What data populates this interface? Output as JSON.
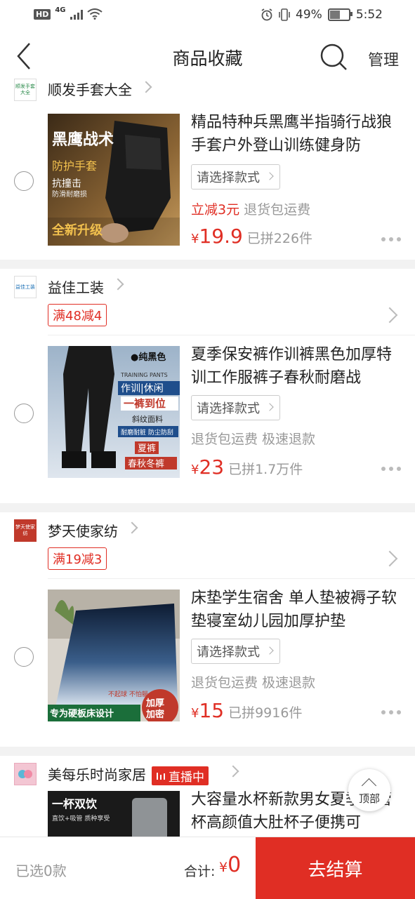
{
  "status_bar": {
    "hd": "HD",
    "net": "4G",
    "battery": "49%",
    "battery_level": 0.49,
    "time": "5:52"
  },
  "navbar": {
    "title": "商品收藏",
    "manage": "管理",
    "back_icon": "back-arrow-icon",
    "search_icon": "search-icon"
  },
  "shops": [
    {
      "name": "顺发手套大全",
      "logo_text": "顺发手套大全",
      "promo": "",
      "item": {
        "title": "精品特种兵黑鹰半指骑行战狼手套户外登山训练健身防",
        "spec": "请选择款式",
        "discount": "立减3元",
        "tags": "退货包运费",
        "currency": "¥",
        "price": "19.9",
        "sold": "已拼226件",
        "img_text": [
          "黑鹰战术",
          "防护手套",
          "抗撞击",
          "防滑耐磨损",
          "全新升级"
        ]
      }
    },
    {
      "name": "益佳工装",
      "logo_text": "益佳工装",
      "promo": "满48减4",
      "item": {
        "title": "夏季保安裤作训裤黑色加厚特训工作服裤子春秋耐磨战",
        "spec": "请选择款式",
        "tags": "退货包运费 极速退款",
        "currency": "¥",
        "price": "23",
        "sold": "已拼1.7万件",
        "img_text": [
          "●纯黑色",
          "TRAINING PANTS",
          "作训|休闲",
          "一裤到位",
          "斜纹面料",
          "耐磨耐脏",
          "防尘防刮",
          "夏裤",
          "春秋冬裤"
        ]
      }
    },
    {
      "name": "梦天使家纺",
      "logo_text": "梦天使家纺",
      "promo": "满19减3",
      "item": {
        "title": "床垫学生宿舍 单人垫被褥子软垫寝室幼儿园加厚护垫",
        "spec": "请选择款式",
        "tags": "退货包运费 极速退款",
        "currency": "¥",
        "price": "15",
        "sold": "已拼9916件",
        "img_text": [
          "不起球 不怕躺",
          "专为硬板床设计",
          "加厚加密"
        ]
      }
    },
    {
      "name": "美每乐时尚家居",
      "live": "直播中",
      "item": {
        "title": "大容量水杯新款男女夏季吸管杯高颜值大肚杯子便携可",
        "img_text": [
          "一杯双饮",
          "直饮+吸管 质种享受"
        ]
      }
    }
  ],
  "top_button": "顶部",
  "bottom_bar": {
    "selected": "已选0款",
    "total_label": "合计:",
    "currency": "¥",
    "total": "0",
    "checkout": "去结算"
  }
}
